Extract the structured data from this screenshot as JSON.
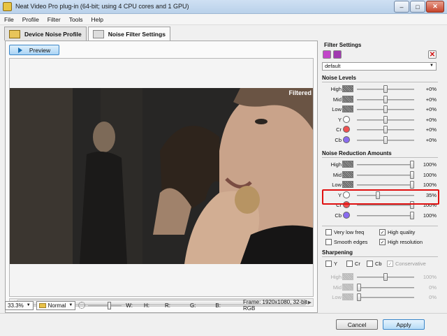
{
  "window": {
    "title": "Neat Video Pro plug-in (64-bit; using 4 CPU cores and 1 GPU)"
  },
  "menu": [
    "File",
    "Profile",
    "Filter",
    "Tools",
    "Help"
  ],
  "tabs": [
    {
      "label": "Device Noise Profile",
      "active": false
    },
    {
      "label": "Noise Filter Settings",
      "active": true
    }
  ],
  "preview": {
    "button_label": "Preview",
    "overlay_label": "Filtered"
  },
  "status": {
    "zoom": "33.3%",
    "mode": "Normal",
    "w_label": "W:",
    "h_label": "H:",
    "r_label": "R:",
    "g_label": "G:",
    "b_label": "B:",
    "frame_info": "Frame: 1920x1080, 32-bit RGB"
  },
  "filter_settings": {
    "title": "Filter Settings",
    "preset": "default",
    "noise_levels_title": "Noise Levels",
    "noise_levels": [
      {
        "label": "High",
        "kind": "texture",
        "level": 0.5,
        "value": "+0%"
      },
      {
        "label": "Mid",
        "kind": "texture",
        "level": 0.5,
        "value": "+0%"
      },
      {
        "label": "Low",
        "kind": "texture",
        "level": 0.5,
        "value": "+0%"
      },
      {
        "label": "Y",
        "kind": "circle",
        "color": "#ffffff",
        "level": 0.5,
        "value": "+0%"
      },
      {
        "label": "Cr",
        "kind": "circle",
        "color": "#f05050",
        "level": 0.5,
        "value": "+0%"
      },
      {
        "label": "Cb",
        "kind": "circle",
        "color": "#8a6cf0",
        "level": 0.5,
        "value": "+0%"
      }
    ],
    "reduction_title": "Noise Reduction Amounts",
    "reduction": [
      {
        "label": "High",
        "kind": "texture",
        "level": 1.0,
        "value": "100%"
      },
      {
        "label": "Mid",
        "kind": "texture",
        "level": 1.0,
        "value": "100%"
      },
      {
        "label": "Low",
        "kind": "texture",
        "level": 1.0,
        "value": "100%"
      },
      {
        "label": "Y",
        "kind": "circle",
        "color": "#ffffff",
        "level": 0.35,
        "value": "35%"
      },
      {
        "label": "Cr",
        "kind": "circle",
        "color": "#f05050",
        "level": 1.0,
        "value": "100%"
      },
      {
        "label": "Cb",
        "kind": "circle",
        "color": "#8a6cf0",
        "level": 1.0,
        "value": "100%"
      }
    ],
    "options": [
      {
        "label": "Very low freq",
        "checked": false
      },
      {
        "label": "High quality",
        "checked": true
      },
      {
        "label": "Smooth edges",
        "checked": false
      },
      {
        "label": "High resolution",
        "checked": true
      }
    ],
    "sharpening_title": "Sharpening",
    "sharpening_channels": [
      {
        "label": "Y",
        "checked": false
      },
      {
        "label": "Cr",
        "checked": false
      },
      {
        "label": "Cb",
        "checked": false
      },
      {
        "label": "Conservative",
        "checked": true
      }
    ],
    "sharpening": [
      {
        "label": "High",
        "level": 0.5,
        "value": "100%"
      },
      {
        "label": "Mid",
        "level": 0.0,
        "value": "0%"
      },
      {
        "label": "Low",
        "level": 0.0,
        "value": "0%"
      }
    ]
  },
  "buttons": {
    "cancel": "Cancel",
    "apply": "Apply"
  },
  "colors": {
    "highlight": "#e01010",
    "accent": "#3a86c8"
  }
}
